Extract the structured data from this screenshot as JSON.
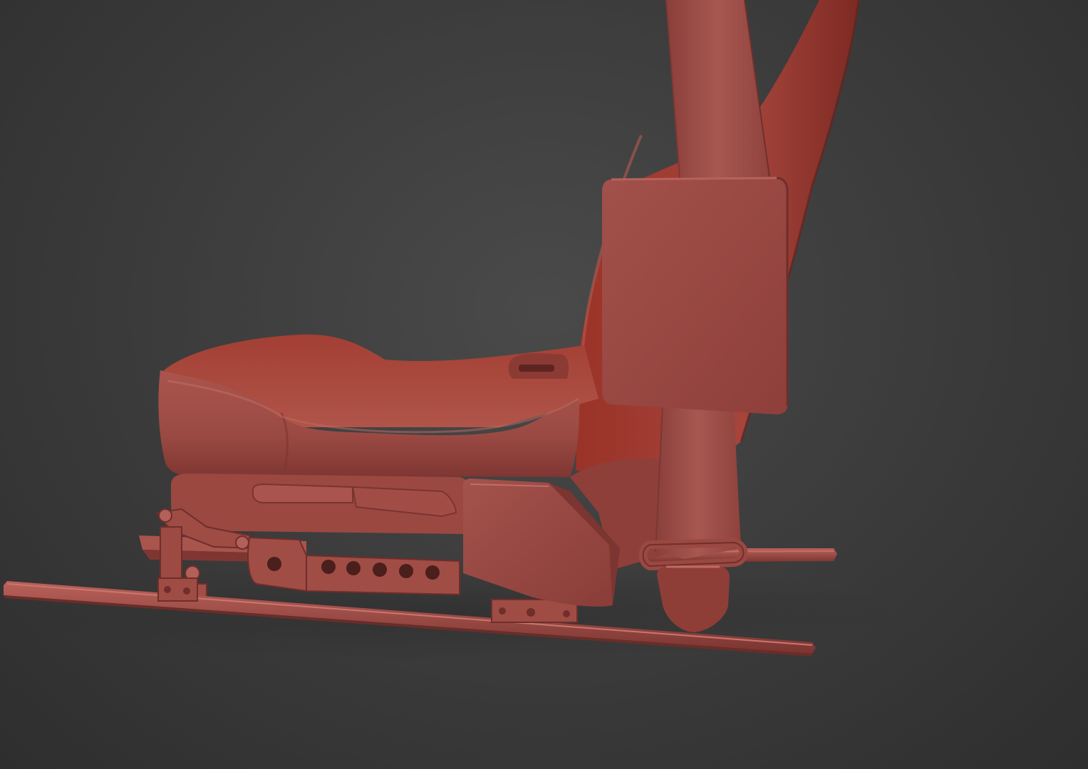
{
  "scene": {
    "subject": "car-seat-3d-render",
    "colors": {
      "background_top": "#474747",
      "background_bottom": "#3a3a3a",
      "clay_base": "#a7524b",
      "clay_light": "#b8625a",
      "clay_mid": "#944640",
      "clay_dark": "#6e302c",
      "clay_shadow": "#5a2623",
      "hole": "#4a1f1c"
    }
  }
}
